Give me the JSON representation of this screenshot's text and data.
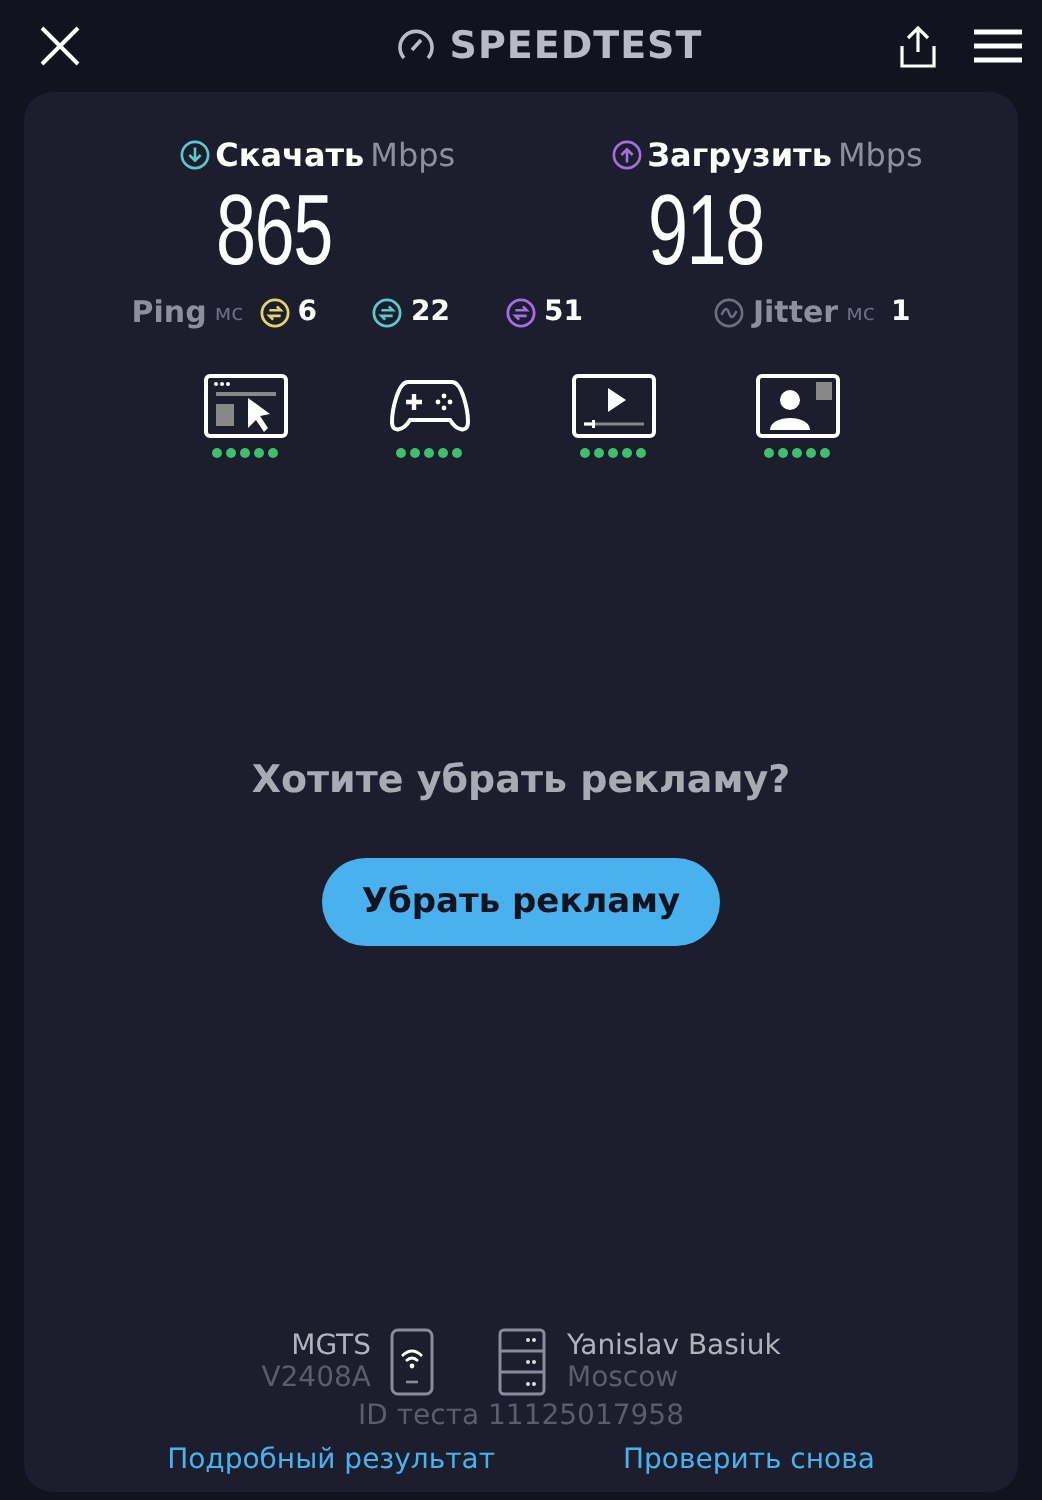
{
  "header": {
    "title": "SPEEDTEST"
  },
  "speeds": [
    {
      "kind": "download",
      "label": "Скачать",
      "unit": "Mbps",
      "value": "865"
    },
    {
      "kind": "upload",
      "label": "Загрузить",
      "unit": "Mbps",
      "value": "918"
    }
  ],
  "ping": {
    "label": "Ping",
    "unit": "мс",
    "values": [
      {
        "value": "6",
        "color": "#e3d36b"
      },
      {
        "value": "22",
        "color": "#5cc9c9"
      },
      {
        "value": "51",
        "color": "#a46fe0"
      }
    ]
  },
  "jitter": {
    "label": "Jitter",
    "unit": "мс",
    "value": "1"
  },
  "activities": [
    {
      "kind": "browse",
      "stars": 5
    },
    {
      "kind": "game",
      "stars": 5
    },
    {
      "kind": "video",
      "stars": 5
    },
    {
      "kind": "call",
      "stars": 5
    }
  ],
  "ad": {
    "question": "Хотите убрать рекламу?",
    "button": "Убрать рекламу"
  },
  "connection": {
    "provider": "MGTS",
    "device": "V2408A",
    "server": "Yanislav Basiuk",
    "location": "Moscow",
    "test_id": "ID теста 11125017958"
  },
  "links": [
    "Подробный результат",
    "Проверить снова"
  ]
}
